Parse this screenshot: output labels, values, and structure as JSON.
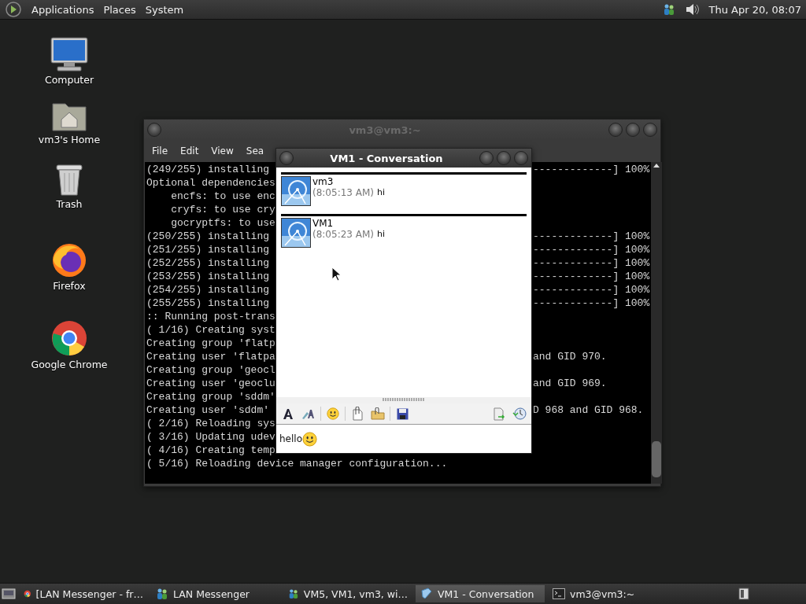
{
  "top_panel": {
    "menus": [
      "Applications",
      "Places",
      "System"
    ],
    "clock": "Thu Apr 20, 08:07"
  },
  "desktop_icons": [
    {
      "label": "Computer",
      "kind": "computer"
    },
    {
      "label": "vm3's Home",
      "kind": "home"
    },
    {
      "label": "Trash",
      "kind": "trash"
    },
    {
      "label": "Firefox",
      "kind": "firefox"
    },
    {
      "label": "Google Chrome",
      "kind": "chrome"
    }
  ],
  "terminal": {
    "title": "vm3@vm3:~",
    "menus": [
      "File",
      "Edit",
      "View",
      "Sea"
    ],
    "lines": [
      {
        "left": "(249/255) installing",
        "right": "-------------] 100%"
      },
      {
        "left": "Optional dependencies"
      },
      {
        "left": "    encfs: to use enc"
      },
      {
        "left": "    cryfs: to use cry"
      },
      {
        "left": "    gocryptfs: to use"
      },
      {
        "left": "(250/255) installing",
        "right": "-------------] 100%"
      },
      {
        "left": "(251/255) installing",
        "right": "-------------] 100%"
      },
      {
        "left": "(252/255) installing",
        "right": "-------------] 100%"
      },
      {
        "left": "(253/255) installing",
        "right": "-------------] 100%"
      },
      {
        "left": "(254/255) installing",
        "right": "-------------] 100%"
      },
      {
        "left": "(255/255) installing",
        "right": "-------------] 100%"
      },
      {
        "left": ":: Running post-trans"
      },
      {
        "left": "( 1/16) Creating syst"
      },
      {
        "left": "Creating group 'flatp"
      },
      {
        "left": "Creating user 'flatpa",
        "right": "and GID 970."
      },
      {
        "left": "Creating group 'geocl"
      },
      {
        "left": "Creating user 'geoclu",
        "right": "and GID 969."
      },
      {
        "left": "Creating group 'sddm'"
      },
      {
        "left": "Creating user 'sddm'",
        "right": "D 968 and GID 968."
      },
      {
        "left": "( 2/16) Reloading sys"
      },
      {
        "left": "( 3/16) Updating udev"
      },
      {
        "left": "( 4/16) Creating temp"
      },
      {
        "left": "( 5/16) Reloading device manager configuration..."
      }
    ]
  },
  "conversation": {
    "title": "VM1 - Conversation",
    "messages": [
      {
        "sender": "vm3",
        "time": "(8:05:13 AM)",
        "text": "hi"
      },
      {
        "sender": "VM1",
        "time": "(8:05:23 AM)",
        "text": "hi"
      }
    ],
    "input": {
      "value": "hello"
    }
  },
  "taskbar": {
    "items": [
      {
        "label": "[LAN Messenger - fr…",
        "kind": "chrome",
        "selected": false
      },
      {
        "label": "LAN Messenger",
        "kind": "messenger",
        "selected": false
      },
      {
        "label": "VM5, VM1, vm3, wi…",
        "kind": "messenger",
        "selected": false
      },
      {
        "label": "VM1 - Conversation",
        "kind": "conversation",
        "selected": true
      },
      {
        "label": "vm3@vm3:~",
        "kind": "terminal",
        "selected": false
      }
    ]
  }
}
